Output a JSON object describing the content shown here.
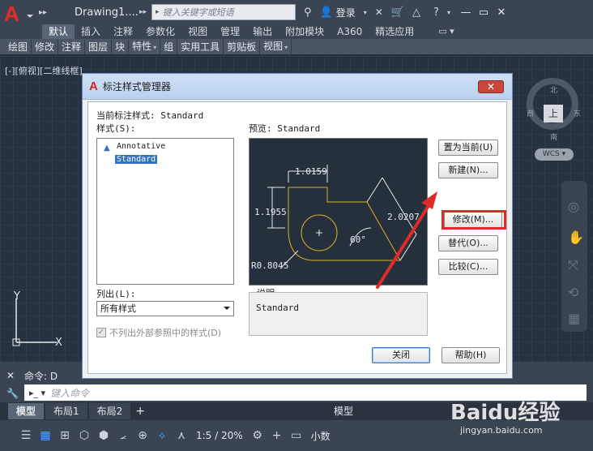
{
  "titlebar": {
    "doc_title": "Drawing1....",
    "search_placeholder": "键入关键字或短语",
    "login_label": "登录",
    "help_label": "?"
  },
  "ribbon": {
    "tabs": [
      "默认",
      "插入",
      "注释",
      "参数化",
      "视图",
      "管理",
      "输出",
      "附加模块",
      "A360",
      "精选应用"
    ],
    "active_tab": "默认",
    "panels": [
      "绘图",
      "修改",
      "注释",
      "图层",
      "块",
      "特性",
      "组",
      "实用工具",
      "剪贴板",
      "视图"
    ]
  },
  "viewport": {
    "label": "[-][俯视][二维线框]",
    "viewcube": {
      "face": "上",
      "north": "北",
      "south": "南",
      "east": "东",
      "west": "西",
      "wcs": "WCS"
    },
    "ucs": {
      "x": "X",
      "y": "Y"
    }
  },
  "dialog": {
    "title": "标注样式管理器",
    "close_label": "✕",
    "current_style_label": "当前标注样式: Standard",
    "styles_label": "样式(S):",
    "styles": [
      "Annotative",
      "Standard"
    ],
    "selected_style": "Standard",
    "preview_label": "预览: Standard",
    "list_label": "列出(L):",
    "list_value": "所有样式",
    "exclude_xref_label": "不列出外部参照中的样式(D)",
    "exclude_xref_checked": true,
    "description_label": "说明",
    "description_text": "Standard",
    "buttons": {
      "set_current": "置为当前(U)",
      "new": "新建(N)...",
      "modify": "修改(M)...",
      "override": "替代(O)...",
      "compare": "比较(C)...",
      "close": "关闭",
      "help": "帮助(H)"
    },
    "preview_dims": {
      "d1": "1.0159",
      "d2": "1.1955",
      "d3": "2.0207",
      "angle": "60°",
      "radius": "R0.8045"
    }
  },
  "command": {
    "history": "命令: D",
    "placeholder": "键入命令"
  },
  "layouts": {
    "tabs": [
      "模型",
      "布局1",
      "布局2"
    ],
    "active": "模型",
    "add": "+",
    "space_label": "模型"
  },
  "statusbar": {
    "scale": "1:5 / 20%",
    "units": "小数"
  },
  "watermark": {
    "text": "Baidu经验",
    "url": "jingyan.baidu.com"
  },
  "colors": {
    "accent": "#3372c4",
    "highlight": "#e02a2a",
    "app_red": "#e42b2b"
  }
}
